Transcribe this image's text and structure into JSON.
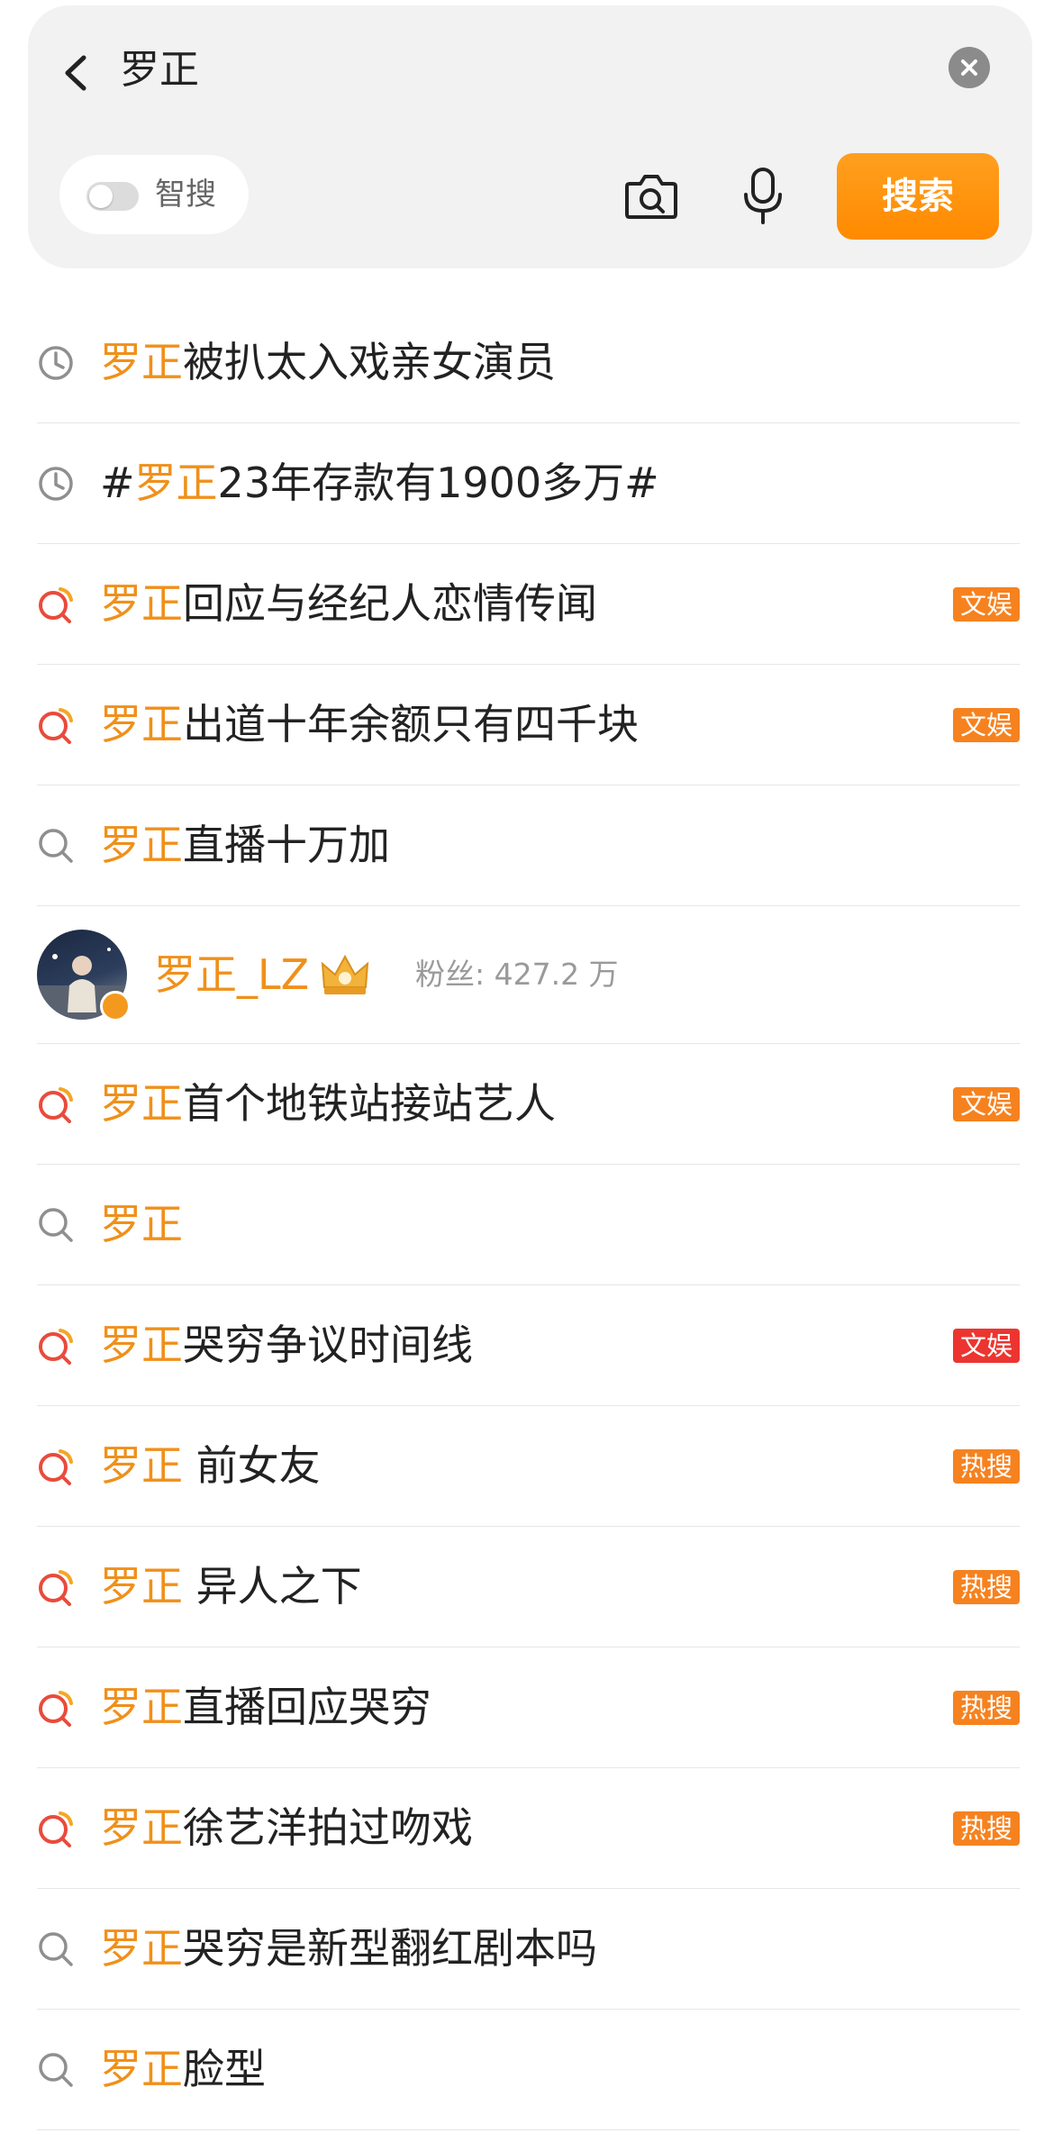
{
  "search": {
    "query": "罗正",
    "smart_label": "智搜",
    "smart_enabled": false,
    "button_label": "搜索",
    "accent_color": "#ff8f0e"
  },
  "rows": [
    {
      "icon": "history-clock-icon",
      "before": "",
      "keyword": "罗正",
      "after": "被扒太入戏亲女演员",
      "tag": "",
      "tag_color": ""
    },
    {
      "icon": "history-clock-icon",
      "before": "#",
      "keyword": "罗正",
      "after": "23年存款有1900多万#",
      "tag": "",
      "tag_color": ""
    },
    {
      "icon": "hot-search-icon",
      "before": "",
      "keyword": "罗正",
      "after": "回应与经纪人恋情传闻",
      "tag": "文娱",
      "tag_color": "#f6821f"
    },
    {
      "icon": "hot-search-icon",
      "before": "",
      "keyword": "罗正",
      "after": "出道十年余额只有四千块",
      "tag": "文娱",
      "tag_color": "#f6821f"
    },
    {
      "icon": "search-icon",
      "before": "",
      "keyword": "罗正",
      "after": "直播十万加",
      "tag": "",
      "tag_color": ""
    },
    {
      "type": "user",
      "name": "罗正_LZ",
      "fans_label": "粉丝: ",
      "fans_count": "427.2 万"
    },
    {
      "icon": "hot-search-icon",
      "before": "",
      "keyword": "罗正",
      "after": "首个地铁站接站艺人",
      "tag": "文娱",
      "tag_color": "#f6821f"
    },
    {
      "icon": "search-icon",
      "before": "",
      "keyword": "罗正",
      "after": "",
      "tag": "",
      "tag_color": ""
    },
    {
      "icon": "hot-search-icon",
      "before": "",
      "keyword": "罗正",
      "after": "哭穷争议时间线",
      "tag": "文娱",
      "tag_color": "#ec3530"
    },
    {
      "icon": "hot-search-icon",
      "before": "",
      "keyword": "罗正",
      "after": " 前女友",
      "tag": "热搜",
      "tag_color": "#f6821f"
    },
    {
      "icon": "hot-search-icon",
      "before": "",
      "keyword": "罗正",
      "after": " 异人之下",
      "tag": "热搜",
      "tag_color": "#f6821f"
    },
    {
      "icon": "hot-search-icon",
      "before": "",
      "keyword": "罗正",
      "after": "直播回应哭穷",
      "tag": "热搜",
      "tag_color": "#f6821f"
    },
    {
      "icon": "hot-search-icon",
      "before": "",
      "keyword": "罗正",
      "after": "徐艺洋拍过吻戏",
      "tag": "热搜",
      "tag_color": "#f6821f"
    },
    {
      "icon": "search-icon",
      "before": "",
      "keyword": "罗正",
      "after": "哭穷是新型翻红剧本吗",
      "tag": "",
      "tag_color": ""
    },
    {
      "icon": "search-icon",
      "before": "",
      "keyword": "罗正",
      "after": "脸型",
      "tag": "",
      "tag_color": ""
    }
  ]
}
